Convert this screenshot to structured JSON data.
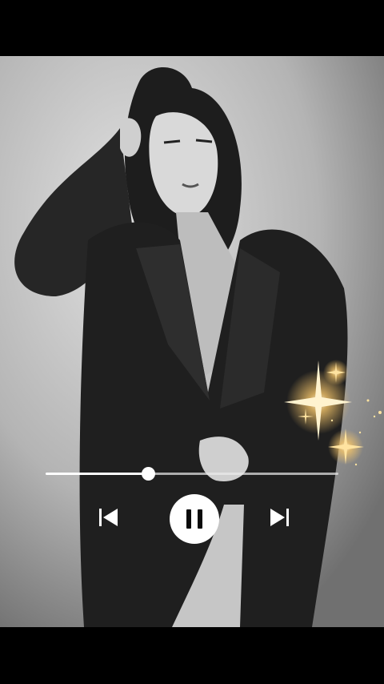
{
  "player": {
    "progress": 0.35,
    "state": "playing",
    "prev_icon": "skip-previous-icon",
    "pause_icon": "pause-icon",
    "next_icon": "skip-next-icon",
    "sparkle_color": "#f3c46a"
  }
}
